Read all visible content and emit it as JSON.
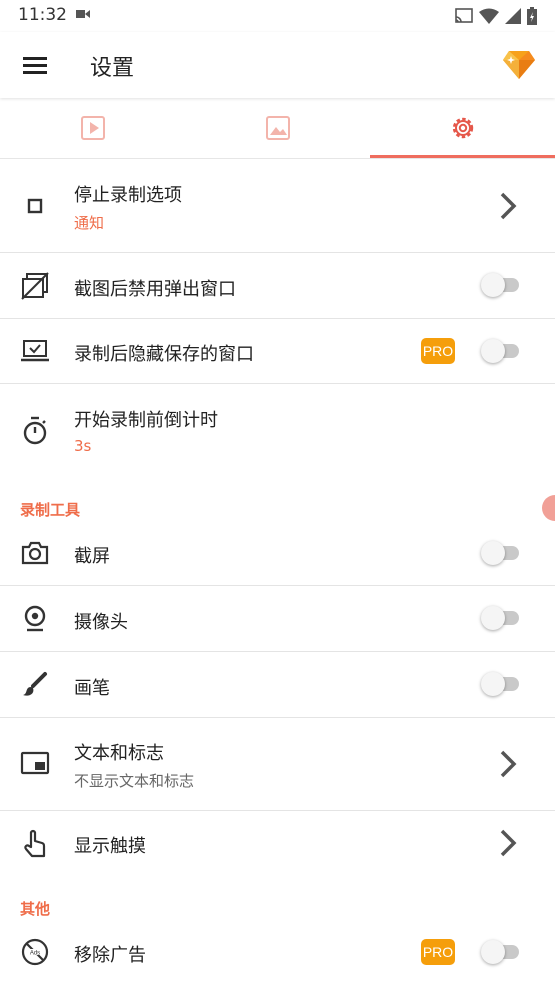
{
  "status_bar": {
    "time": "11:32"
  },
  "app_bar": {
    "title": "设置"
  },
  "tabs": [
    {
      "name": "video",
      "active": false
    },
    {
      "name": "image",
      "active": false
    },
    {
      "name": "settings",
      "active": true
    }
  ],
  "colors": {
    "accent": "#ef6d4a",
    "pro_badge": "#f59e0b",
    "toggle_off": "#c9c9c9"
  },
  "settings": {
    "stop_options": {
      "title": "停止录制选项",
      "value": "通知"
    },
    "disable_popup": {
      "title": "截图后禁用弹出窗口",
      "enabled": false
    },
    "hide_saved": {
      "title": "录制后隐藏保存的窗口",
      "badge": "PRO",
      "enabled": false
    },
    "countdown": {
      "title": "开始录制前倒计时",
      "value": "3s"
    }
  },
  "tools": {
    "header": "录制工具",
    "screenshot": {
      "title": "截屏",
      "enabled": false
    },
    "camera": {
      "title": "摄像头",
      "enabled": false
    },
    "brush": {
      "title": "画笔",
      "enabled": false
    },
    "text_logo": {
      "title": "文本和标志",
      "value": "不显示文本和标志"
    },
    "show_touch": {
      "title": "显示触摸"
    }
  },
  "other": {
    "header": "其他",
    "remove_ads": {
      "title": "移除广告",
      "badge": "PRO",
      "enabled": false
    }
  }
}
